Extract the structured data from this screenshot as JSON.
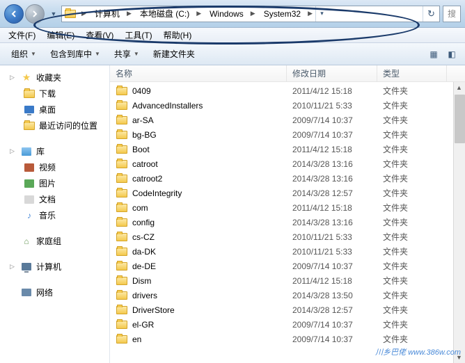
{
  "breadcrumb": {
    "items": [
      "计算机",
      "本地磁盘 (C:)",
      "Windows",
      "System32"
    ]
  },
  "search": {
    "placeholder": "搜"
  },
  "menubar": {
    "file": "文件(F)",
    "edit": "编辑(E)",
    "view": "查看(V)",
    "tools": "工具(T)",
    "help": "帮助(H)"
  },
  "toolbar": {
    "organize": "组织",
    "include": "包含到库中",
    "share": "共享",
    "newfolder": "新建文件夹"
  },
  "sidebar": {
    "favorites": {
      "label": "收藏夹",
      "items": [
        "下载",
        "桌面",
        "最近访问的位置"
      ]
    },
    "libraries": {
      "label": "库",
      "items": [
        "视频",
        "图片",
        "文档",
        "音乐"
      ]
    },
    "homegroup": {
      "label": "家庭组"
    },
    "computer": {
      "label": "计算机"
    },
    "network": {
      "label": "网络"
    }
  },
  "columns": {
    "name": "名称",
    "date": "修改日期",
    "type": "类型"
  },
  "files": [
    {
      "name": "0409",
      "date": "2011/4/12 15:18",
      "type": "文件夹"
    },
    {
      "name": "AdvancedInstallers",
      "date": "2010/11/21 5:33",
      "type": "文件夹"
    },
    {
      "name": "ar-SA",
      "date": "2009/7/14 10:37",
      "type": "文件夹"
    },
    {
      "name": "bg-BG",
      "date": "2009/7/14 10:37",
      "type": "文件夹"
    },
    {
      "name": "Boot",
      "date": "2011/4/12 15:18",
      "type": "文件夹"
    },
    {
      "name": "catroot",
      "date": "2014/3/28 13:16",
      "type": "文件夹"
    },
    {
      "name": "catroot2",
      "date": "2014/3/28 13:16",
      "type": "文件夹"
    },
    {
      "name": "CodeIntegrity",
      "date": "2014/3/28 12:57",
      "type": "文件夹"
    },
    {
      "name": "com",
      "date": "2011/4/12 15:18",
      "type": "文件夹"
    },
    {
      "name": "config",
      "date": "2014/3/28 13:16",
      "type": "文件夹"
    },
    {
      "name": "cs-CZ",
      "date": "2010/11/21 5:33",
      "type": "文件夹"
    },
    {
      "name": "da-DK",
      "date": "2010/11/21 5:33",
      "type": "文件夹"
    },
    {
      "name": "de-DE",
      "date": "2009/7/14 10:37",
      "type": "文件夹"
    },
    {
      "name": "Dism",
      "date": "2011/4/12 15:18",
      "type": "文件夹"
    },
    {
      "name": "drivers",
      "date": "2014/3/28 13:50",
      "type": "文件夹"
    },
    {
      "name": "DriverStore",
      "date": "2014/3/28 12:57",
      "type": "文件夹"
    },
    {
      "name": "el-GR",
      "date": "2009/7/14 10:37",
      "type": "文件夹"
    },
    {
      "name": "en",
      "date": "2009/7/14 10:37",
      "type": "文件夹"
    }
  ],
  "watermark": "川乡巴佬 www.386w.com"
}
